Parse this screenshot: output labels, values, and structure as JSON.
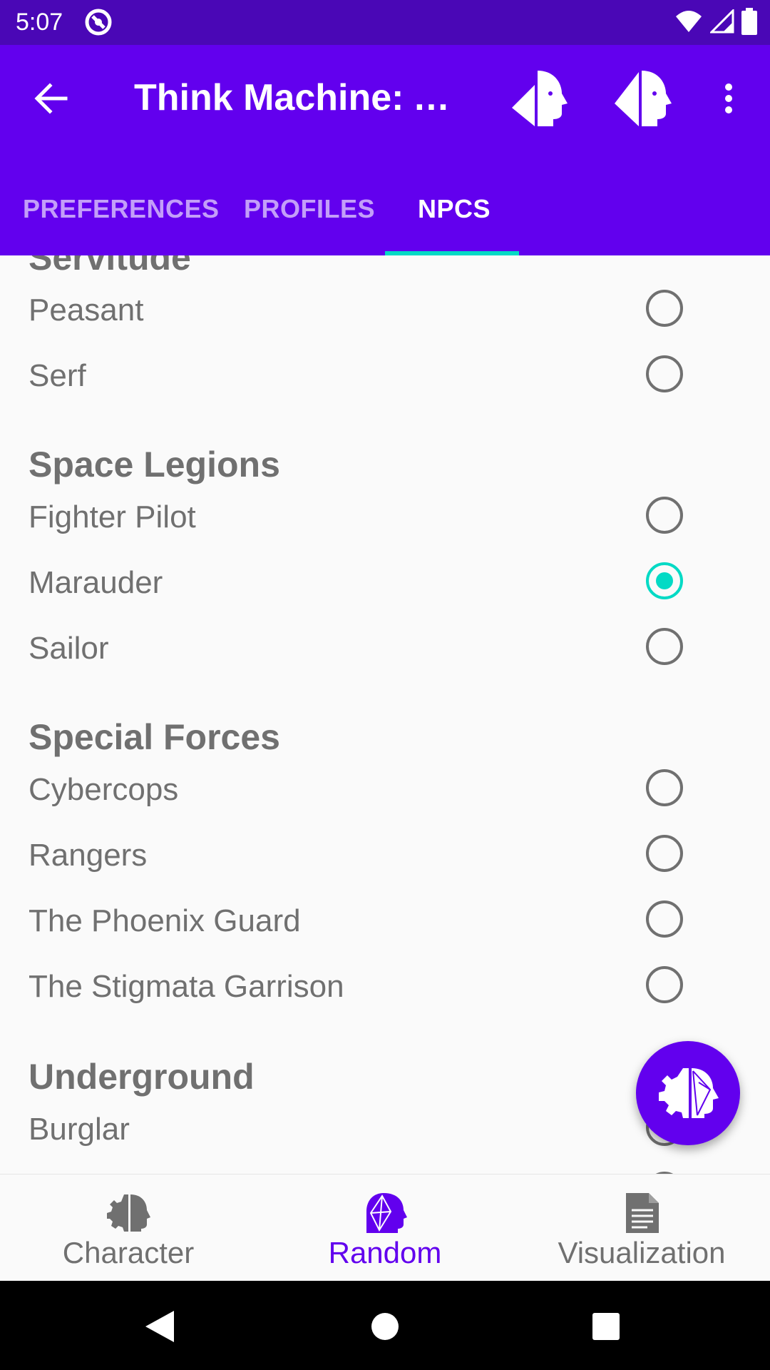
{
  "status_bar": {
    "time": "5:07"
  },
  "app_bar": {
    "title": "Think Machine: A..."
  },
  "tabs": [
    {
      "label": "PREFERENCES"
    },
    {
      "label": "PROFILES"
    },
    {
      "label": "NPCS"
    }
  ],
  "groups": [
    {
      "title": "Servitude",
      "items": [
        {
          "label": "Peasant",
          "checked": false
        },
        {
          "label": "Serf",
          "checked": false
        }
      ]
    },
    {
      "title": "Space Legions",
      "items": [
        {
          "label": "Fighter Pilot",
          "checked": false
        },
        {
          "label": "Marauder",
          "checked": true
        },
        {
          "label": "Sailor",
          "checked": false
        }
      ]
    },
    {
      "title": "Special Forces",
      "items": [
        {
          "label": "Cybercops",
          "checked": false
        },
        {
          "label": "Rangers",
          "checked": false
        },
        {
          "label": "The Phoenix Guard",
          "checked": false
        },
        {
          "label": "The Stigmata Garrison",
          "checked": false
        }
      ]
    },
    {
      "title": "Underground",
      "items": [
        {
          "label": "Burglar",
          "checked": false
        }
      ]
    }
  ],
  "bottom_nav": [
    {
      "label": "Character",
      "icon": "head-gear-icon"
    },
    {
      "label": "Random",
      "icon": "random-head-icon"
    },
    {
      "label": "Visualization",
      "icon": "document-icon"
    }
  ],
  "colors": {
    "primary": "#6200ee",
    "status_bar": "#4a07b6",
    "accent": "#03dac5",
    "text": "#707070"
  }
}
